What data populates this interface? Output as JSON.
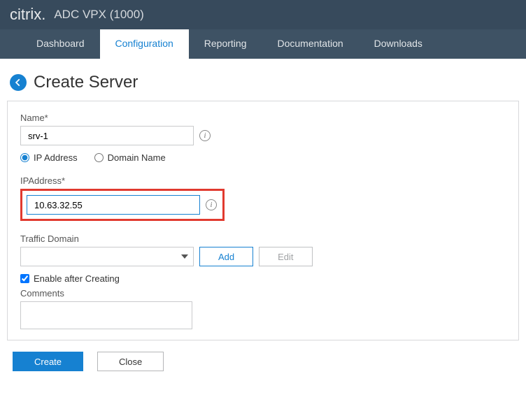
{
  "header": {
    "logo_prefix": "citr",
    "logo_i": "i",
    "logo_x": "x",
    "product": "ADC VPX (1000)"
  },
  "tabs": {
    "items": [
      {
        "label": "Dashboard",
        "active": false
      },
      {
        "label": "Configuration",
        "active": true
      },
      {
        "label": "Reporting",
        "active": false
      },
      {
        "label": "Documentation",
        "active": false
      },
      {
        "label": "Downloads",
        "active": false
      }
    ]
  },
  "page": {
    "title": "Create Server"
  },
  "form": {
    "name_label": "Name*",
    "name_value": "srv-1",
    "radio_ip_label": "IP Address",
    "radio_domain_label": "Domain Name",
    "ipaddress_label": "IPAddress*",
    "ipaddress_value": "10.63.32.55",
    "traffic_domain_label": "Traffic Domain",
    "add_label": "Add",
    "edit_label": "Edit",
    "enable_after_creating_label": "Enable after Creating",
    "comments_label": "Comments"
  },
  "footer": {
    "create_label": "Create",
    "close_label": "Close"
  }
}
